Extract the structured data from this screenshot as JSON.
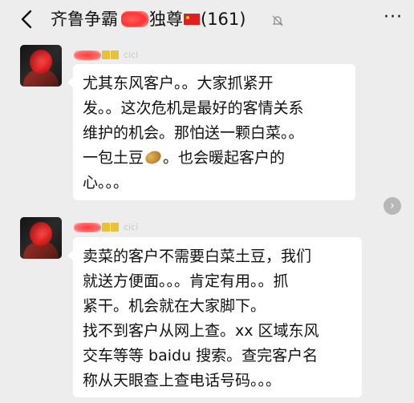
{
  "header": {
    "back_icon": "chevron-left-icon",
    "title_prefix": "齐鲁争霸",
    "title_mid": "独尊",
    "title_count": "(161)",
    "mute_icon": "bell-muted-icon",
    "more_icon": "more-dots-icon",
    "more_label": "···"
  },
  "messages": [
    {
      "sender_nick": "cici",
      "lines": [
        "尤其东风客户。。大家抓紧开",
        "发。。这次危机是最好的客情关系",
        "维护的机会。那怕送一颗白菜。。",
        "一包土豆",
        "。也会暖起客户的",
        "心。。。"
      ]
    },
    {
      "sender_nick": "cici",
      "lines": [
        "卖菜的客户不需要白菜土豆，我们",
        "就送方便面。。。肯定有用。。抓",
        "紧干。机会就在大家脚下。",
        "找不到客户从网上查。xx 区域东风",
        "交车等等 baidu 搜索。查完客户名",
        "称从天眼查上查电话号码。。。"
      ]
    }
  ],
  "scroll_button_icon": "chevron-right-icon",
  "colors": {
    "background": "#ededed",
    "bubble": "#ffffff",
    "text": "#111111",
    "redaction": "#ff3b3b"
  }
}
